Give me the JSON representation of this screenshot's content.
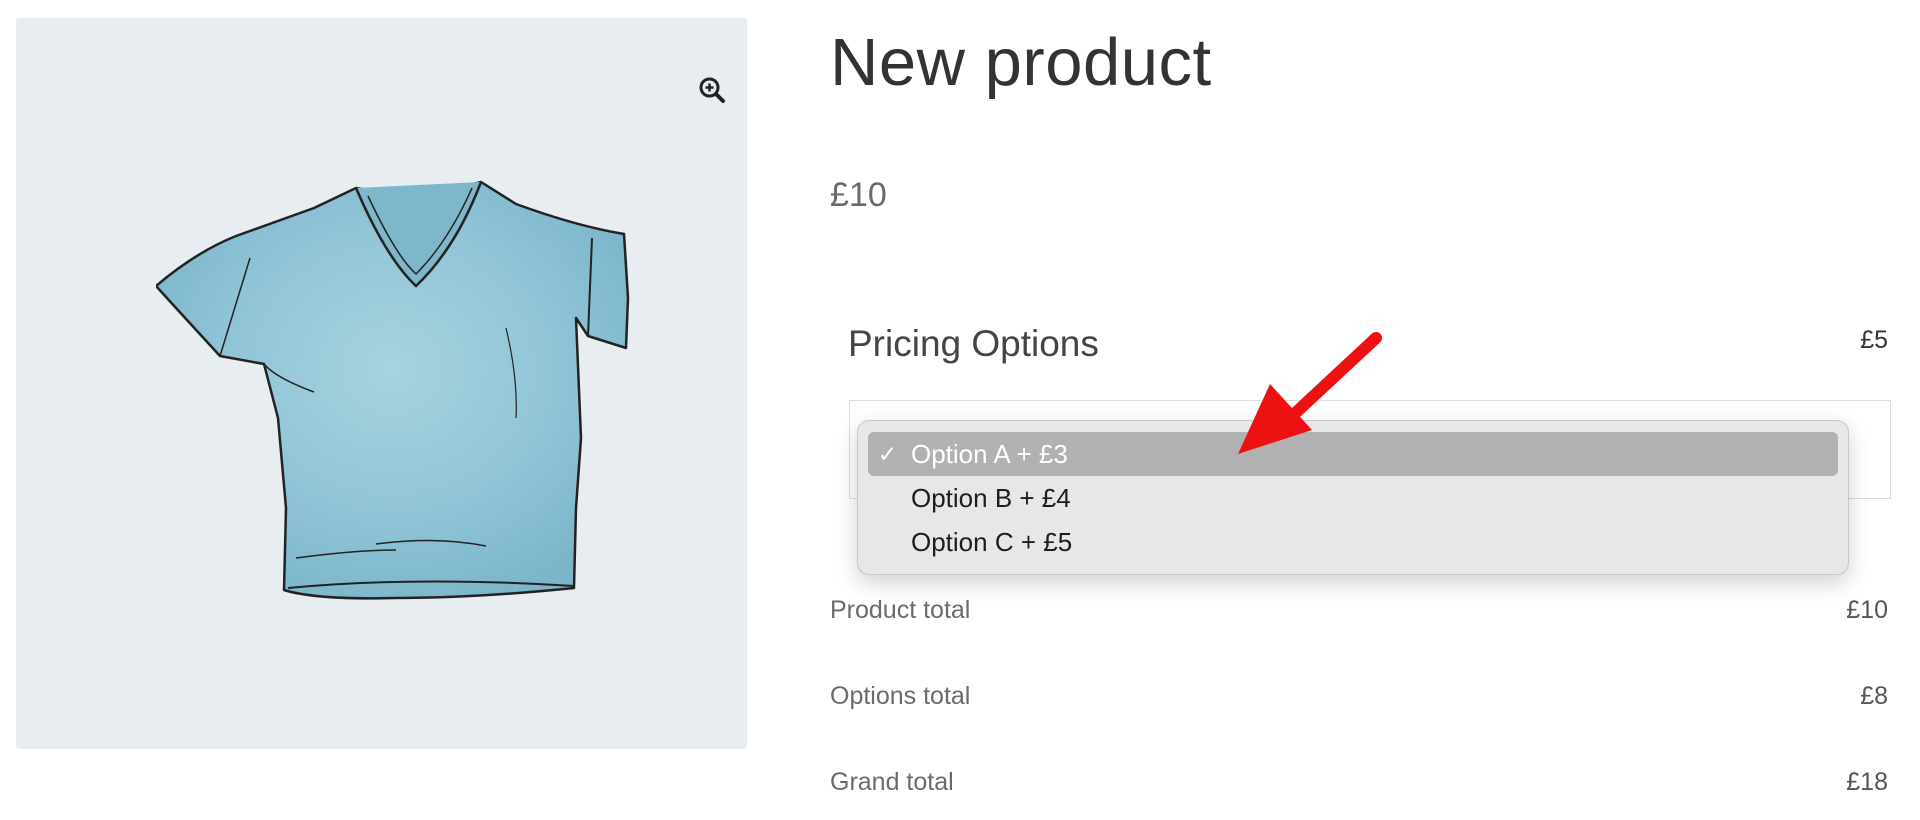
{
  "product": {
    "title": "New product",
    "price": "£10"
  },
  "gallery": {
    "zoom_icon": "zoom-in-icon",
    "image_alt": "blue v-neck t-shirt"
  },
  "pricing_options": {
    "heading": "Pricing Options",
    "price": "£5",
    "dropdown": {
      "selected_index": 0,
      "check_glyph": "✓",
      "options": [
        "Option A + £3",
        "Option B + £4",
        "Option C + £5"
      ]
    }
  },
  "totals": {
    "product_total_label": "Product total",
    "product_total_value": "£10",
    "options_total_label": "Options total",
    "options_total_value": "£8",
    "grand_total_label": "Grand total",
    "grand_total_value": "£18"
  },
  "colors": {
    "gallery_bg": "#e8edf2",
    "annotation_arrow": "#ee1111",
    "selected_option_bg": "#b1b1b1",
    "shirt_fill": "#8fc4d6"
  }
}
